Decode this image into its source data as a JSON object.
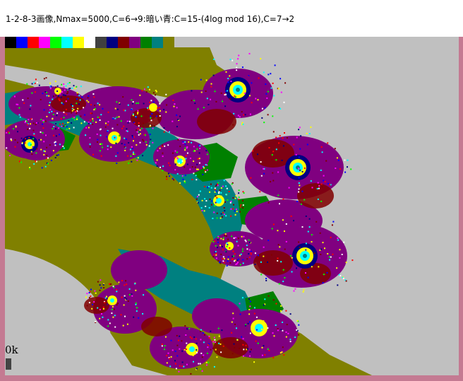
{
  "window": {
    "title": "1-2-8-3画像,Nmax=5000,C=6→9:暗い青:C=15-(4log mod 16),C=7→2"
  },
  "palette": {
    "colors": [
      "#000000",
      "#0000ff",
      "#ff0000",
      "#ff00ff",
      "#00ff00",
      "#00ffff",
      "#ffff00",
      "#ffffff",
      "#404040",
      "#000080",
      "#800000",
      "#800080",
      "#008000",
      "#008080",
      "#808000"
    ]
  },
  "canvas": {
    "background_color": "#c0c0c0",
    "fill_colors": {
      "olive": "#808000",
      "teal": "#008080",
      "purple": "#800080",
      "green": "#008000",
      "maroon": "#800000",
      "navy": "#000080",
      "light_gray": "#c0c0c0"
    },
    "status_text": "0k"
  }
}
